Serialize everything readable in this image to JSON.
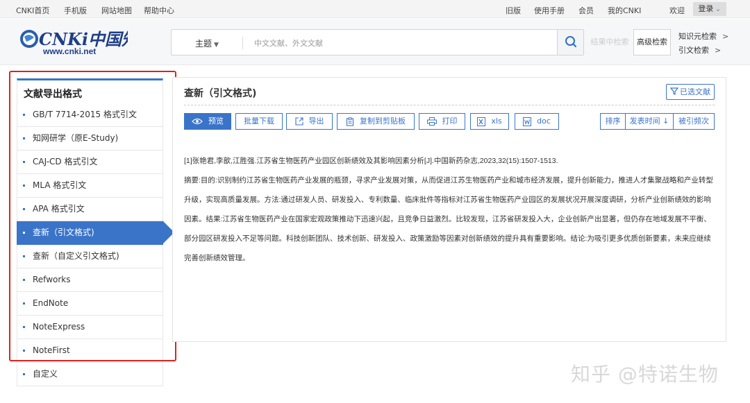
{
  "topbar": {
    "left_links": [
      "CNKI首页",
      "手机版",
      "网站地图",
      "帮助中心"
    ],
    "right_links": [
      "旧版",
      "使用手册",
      "会员",
      "我的CNKI",
      "欢迎"
    ],
    "login_label": "登录"
  },
  "header": {
    "logo_text": "CNKi中国知网",
    "logo_url_text": "www.cnki.net",
    "search_field": "主题",
    "search_placeholder": "中文文献、外文文献",
    "in_result_search": "结果中检索",
    "advanced_search": "高级检索",
    "side_links": [
      "知识元检索",
      "引文检索"
    ]
  },
  "sidebar": {
    "title": "文献导出格式",
    "items": [
      "GB/T 7714-2015 格式引文",
      "知网研学（原E-Study)",
      "CAJ-CD 格式引文",
      "MLA 格式引文",
      "APA 格式引文",
      "查新（引文格式)",
      "查新（自定义引文格式)",
      "Refworks",
      "EndNote",
      "NoteExpress",
      "NoteFirst",
      "自定义"
    ],
    "active_index": 5
  },
  "main": {
    "title": "查新（引文格式)",
    "selected_docs": "已选文献",
    "toolbar": {
      "preview": "预览",
      "batch_download": "批量下载",
      "export": "导出",
      "copy": "复制到剪贴板",
      "print": "打印",
      "xls": "xls",
      "doc": "doc"
    },
    "sort": {
      "label": "排序",
      "by_date": "发表时间",
      "by_cited": "被引频次"
    },
    "citation": {
      "reference": "[1]张艳君,李歆,江胜强.江苏省生物医药产业园区创新绩效及其影响因素分析[J].中国新药杂志,2023,32(15):1507-1513.",
      "abstract": "摘要:目的:识别制约江苏省生物医药产业发展的瓶颈，寻求产业发展对策，从而促进江苏生物医药产业和城市经济发展，提升创新能力，推进人才集聚战略和产业转型升级，实现高质量发展。方法:通过研发人员、研发投入、专利数量、临床批件等指标对江苏省生物医药产业园区的发展状况开展深度调研，分析产业创新绩效的影响因素。结果:江苏省生物医药产业在国家宏观政策推动下迅速兴起，且竞争日益激烈。比较发现，江苏省研发投入大，企业创新产出显著，但仍存在地域发展不平衡、部分园区研发投入不足等问题。科技创新团队、技术创新、研发投入、政策激励等因素对创新绩效的提升具有重要影响。结论:为吸引更多优质创新要素，未来应继续完善创新绩效管理。"
    }
  },
  "watermark": "知乎 @特诺生物",
  "colors": {
    "accent": "#3a74c9",
    "highlight_box": "#e0201e"
  }
}
